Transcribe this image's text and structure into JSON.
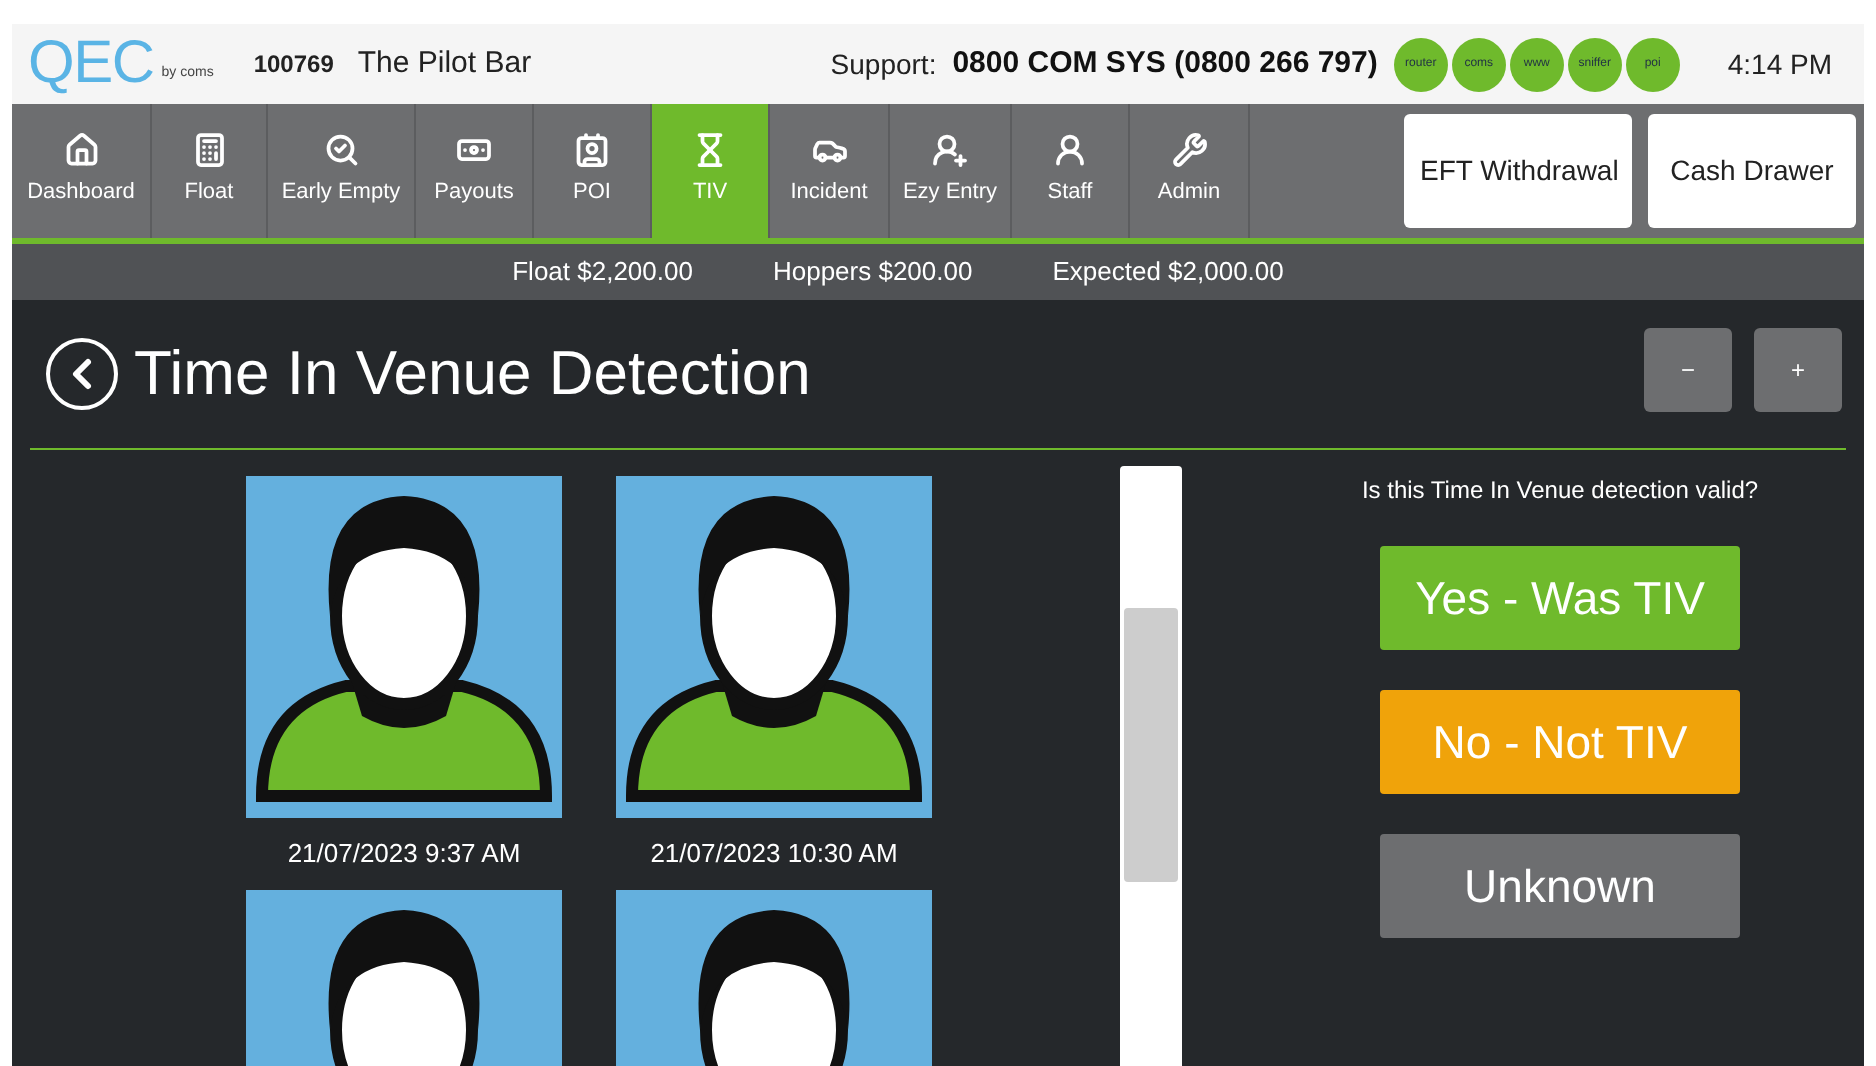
{
  "header": {
    "logo": "QEC",
    "logo_byline": "by coms",
    "venue_id": "100769",
    "venue_name": "The Pilot Bar",
    "support_label": "Support:",
    "support_number": "0800 COM SYS (0800 266 797)",
    "status_lights": [
      {
        "label": "router",
        "color": "#6fba2c"
      },
      {
        "label": "coms",
        "color": "#6fba2c"
      },
      {
        "label": "www",
        "color": "#6fba2c"
      },
      {
        "label": "sniffer",
        "color": "#6fba2c"
      },
      {
        "label": "poi",
        "color": "#6fba2c"
      }
    ],
    "time": "4:14 PM"
  },
  "nav": {
    "items": [
      {
        "label": "Dashboard",
        "selected": false
      },
      {
        "label": "Float",
        "selected": false
      },
      {
        "label": "Early Empty",
        "selected": false
      },
      {
        "label": "Payouts",
        "selected": false
      },
      {
        "label": "POI",
        "selected": false
      },
      {
        "label": "TIV",
        "selected": true
      },
      {
        "label": "Incident",
        "selected": false
      },
      {
        "label": "Ezy Entry",
        "selected": false
      },
      {
        "label": "Staff",
        "selected": false
      },
      {
        "label": "Admin",
        "selected": false
      }
    ],
    "actions": [
      "EFT Withdrawal",
      "Cash Drawer"
    ]
  },
  "summary": [
    "Float $2,200.00",
    "Hoppers $200.00",
    "Expected $2,000.00"
  ],
  "page": {
    "title": "Time In Venue Detection",
    "zoom_buttons": [
      "−",
      "+"
    ]
  },
  "detections": [
    {
      "kind": "captioned",
      "timestamp": "21/07/2023 9:37 AM"
    },
    {
      "kind": "captioned",
      "timestamp": "21/07/2023 10:30 AM"
    },
    {
      "kind": "cut_off"
    },
    {
      "kind": "cut_off"
    }
  ],
  "question": "Is this Time In Venue detection valid?",
  "answers": [
    {
      "kind": "yes",
      "label": "Yes - Was TIV"
    },
    {
      "kind": "no",
      "label": "No - Not TIV"
    },
    {
      "kind": "unknown",
      "label": "Unknown"
    }
  ]
}
